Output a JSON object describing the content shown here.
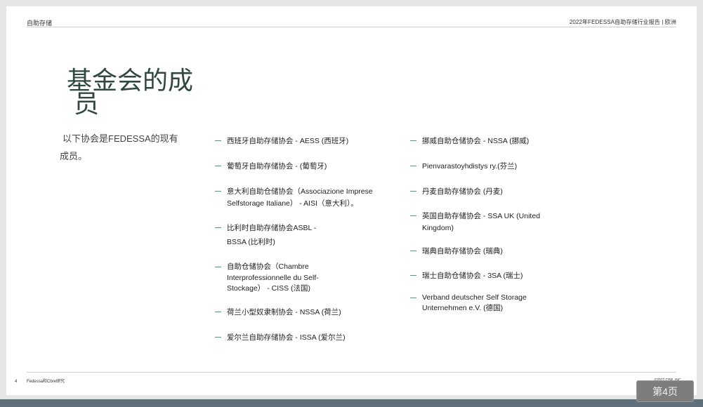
{
  "header": {
    "left": "自助存储",
    "right": "2022年FEDESSA自助存储行业报告 | 欧洲"
  },
  "title": {
    "line1": "基金会的成",
    "line2": "员"
  },
  "intro": {
    "line1": "以下协会是FEDESSA的现有",
    "line2": "成员。"
  },
  "members_left": [
    {
      "lines": [
        "西班牙自助存储协会 - AESS (西班牙)"
      ]
    },
    {
      "lines": [
        "葡萄牙自助存储协会 - (葡萄牙)"
      ]
    },
    {
      "lines": [
        "意大利自助仓储协会（Associazione Imprese",
        "Selfstorage Italiane） - AISI（意大利）。"
      ]
    },
    {
      "lines": [
        "比利时自助存储协会ASBL -",
        "BSSA (比利时)"
      ]
    },
    {
      "lines": [
        "自助仓储协会（Chambre",
        "Interprofessionnelle du Self-",
        "Stockage） - CISS (法国)"
      ]
    },
    {
      "lines": [
        "荷兰小型奴隶制协会 - NSSA (荷兰)"
      ]
    },
    {
      "lines": [
        "爱尔兰自助存储协会 - ISSA (爱尔兰)"
      ]
    }
  ],
  "members_right": [
    {
      "lines": [
        "挪威自助仓储协会 - NSSA (挪威)"
      ]
    },
    {
      "lines": [
        "Pienvarastoyhdistys ry.(芬兰)"
      ]
    },
    {
      "lines": [
        "丹麦自助存储协会 (丹麦)"
      ]
    },
    {
      "lines": [
        "英国自助存储协会 - SSA UK (United",
        "Kingdom)"
      ]
    },
    {
      "lines": [
        "瑞典自助存储协会 (瑞典)"
      ]
    },
    {
      "lines": [
        "瑞士自助仓储协会 - 3SA (瑞士)"
      ]
    },
    {
      "lines": [
        "Verband deutscher Self Storage",
        "Unternehmen e.V. (德国)"
      ]
    }
  ],
  "footer": {
    "page_number": "4",
    "left": "Fedessa和Cbre研究",
    "right": "©2022 CBR, INC."
  },
  "page_badge": "第4页",
  "colors": {
    "title": "#2f4a3c",
    "bullet_dash": "#3fa37a",
    "footer_band": "#5f707a"
  }
}
